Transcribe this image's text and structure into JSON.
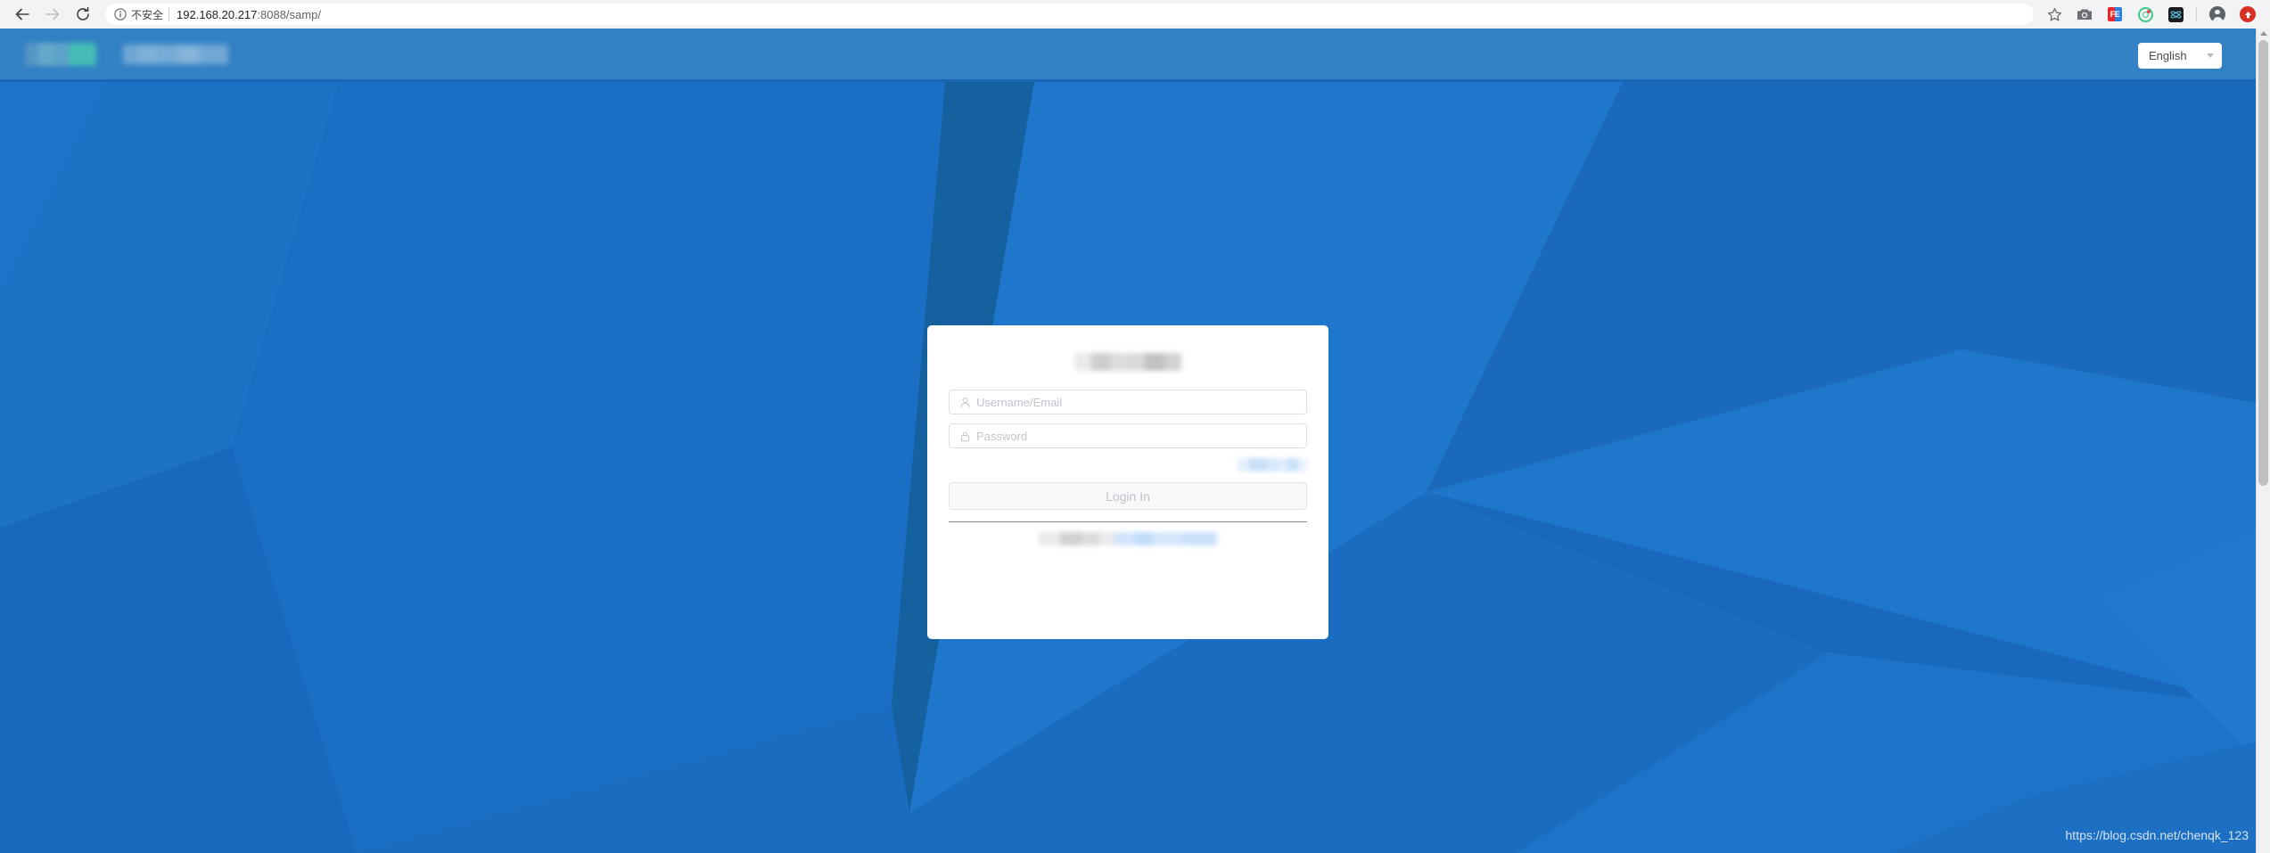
{
  "browser": {
    "back_icon": "back-arrow-icon",
    "forward_icon": "forward-arrow-icon",
    "reload_icon": "reload-icon",
    "security_icon": "info-circle-icon",
    "security_label": "不安全",
    "url_host": "192.168.20.217",
    "url_path": ":8088/samp/",
    "url_full": "192.168.20.217:8088/samp/",
    "toolbar_icons": [
      {
        "name": "bookmark-star-icon",
        "label": ""
      },
      {
        "name": "screenshot-camera-icon",
        "label": ""
      },
      {
        "name": "fe-extension-icon",
        "label": "FE"
      },
      {
        "name": "radar-extension-icon",
        "label": ""
      },
      {
        "name": "react-devtools-icon",
        "label": ""
      },
      {
        "name": "profile-avatar-icon",
        "label": ""
      },
      {
        "name": "update-chrome-icon",
        "label": ""
      }
    ]
  },
  "app_header": {
    "logo_redacted": "",
    "brand_text_redacted": "",
    "language": {
      "selected": "English",
      "chevron_icon": "chevron-down-icon"
    }
  },
  "login_card": {
    "title_redacted": "",
    "username": {
      "icon": "user-icon",
      "placeholder": "Username/Email",
      "value": ""
    },
    "password": {
      "icon": "lock-icon",
      "placeholder": "Password",
      "value": ""
    },
    "forgot_link_redacted": "",
    "submit_label": "Login In",
    "footer_redacted": ""
  },
  "watermark": {
    "text": "https://blog.csdn.net/chenqk_123"
  },
  "colors": {
    "page_background": "#1b6cbf",
    "header_background": "#3281c4",
    "header_border": "#1a65b5",
    "card_background": "#ffffff",
    "button_background": "#f7f8f9",
    "placeholder_text": "#c0c4cc"
  }
}
